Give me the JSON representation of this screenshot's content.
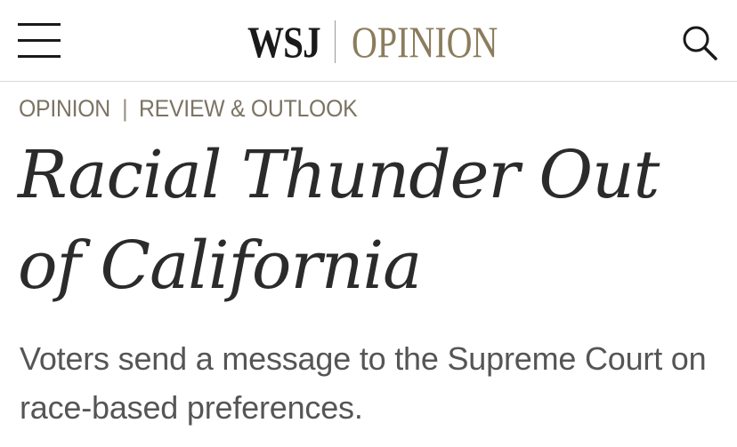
{
  "header": {
    "brand_wsj": "WSJ",
    "brand_section": "OPINION"
  },
  "icons": {
    "menu": "hamburger-menu-icon",
    "search": "search-icon"
  },
  "breadcrumb": {
    "section": "OPINION",
    "separator": "|",
    "subsection": "REVIEW & OUTLOOK"
  },
  "article": {
    "headline": "Racial Thunder Out of California",
    "dek": "Voters send a message to the Supreme Court on race-based preferences."
  },
  "colors": {
    "brand_gold": "#8b7d5c",
    "text_dark": "#2b2b2b",
    "text_gray": "#555555"
  }
}
